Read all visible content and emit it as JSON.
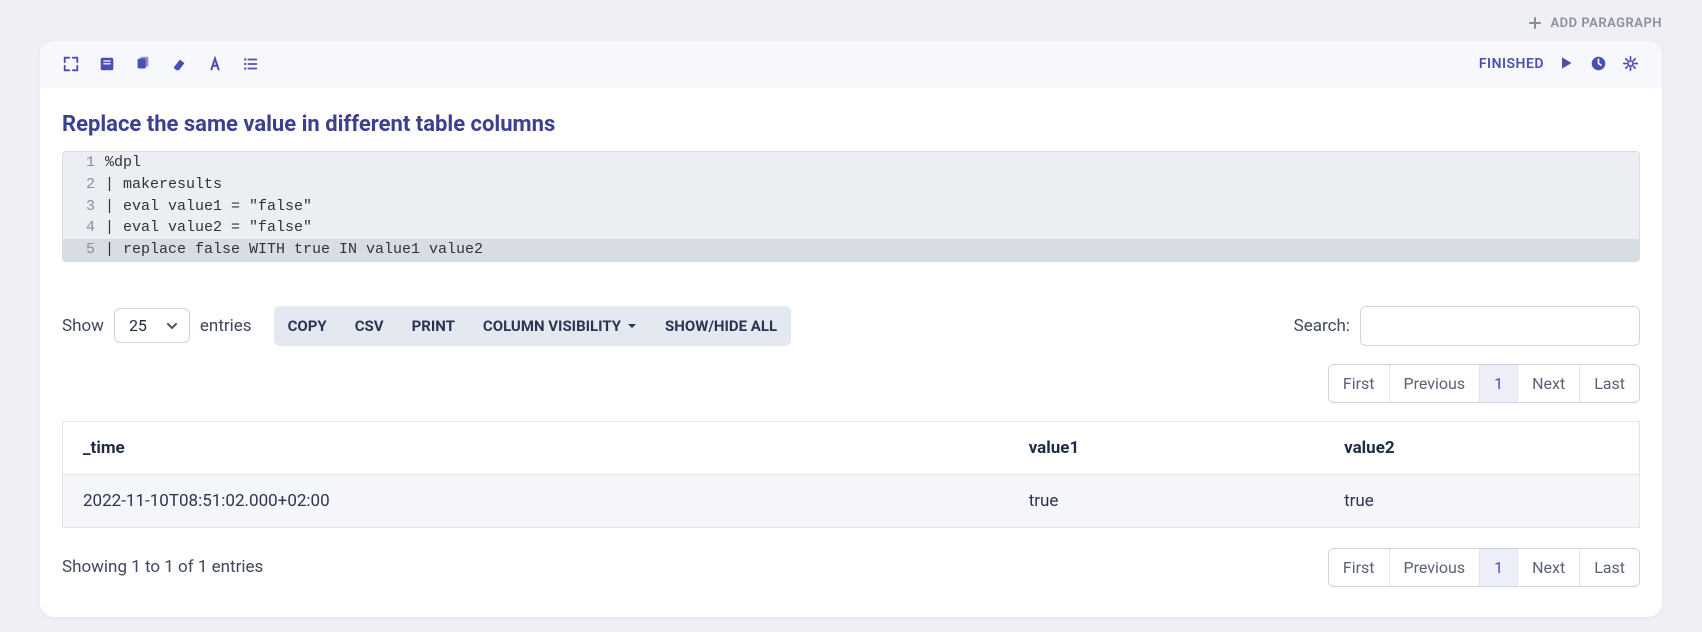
{
  "header": {
    "add_paragraph": "ADD PARAGRAPH",
    "status": "FINISHED"
  },
  "cell": {
    "title": "Replace the same value in different table columns",
    "code": [
      "%dpl",
      "| makeresults",
      "| eval value1 = \"false\"",
      "| eval value2 = \"false\"",
      "| replace false WITH true IN value1 value2"
    ]
  },
  "controls": {
    "show_label": "Show",
    "page_size": "25",
    "entries_label": "entries",
    "buttons": {
      "copy": "COPY",
      "csv": "CSV",
      "print": "PRINT",
      "colvis": "COLUMN VISIBILITY",
      "showhide": "SHOW/HIDE ALL"
    },
    "search_label": "Search:"
  },
  "pagination": {
    "first": "First",
    "prev": "Previous",
    "page": "1",
    "next": "Next",
    "last": "Last"
  },
  "table": {
    "columns": [
      "_time",
      "value1",
      "value2"
    ],
    "rows": [
      [
        "2022-11-10T08:51:02.000+02:00",
        "true",
        "true"
      ]
    ]
  },
  "info": "Showing 1 to 1 of 1 entries"
}
